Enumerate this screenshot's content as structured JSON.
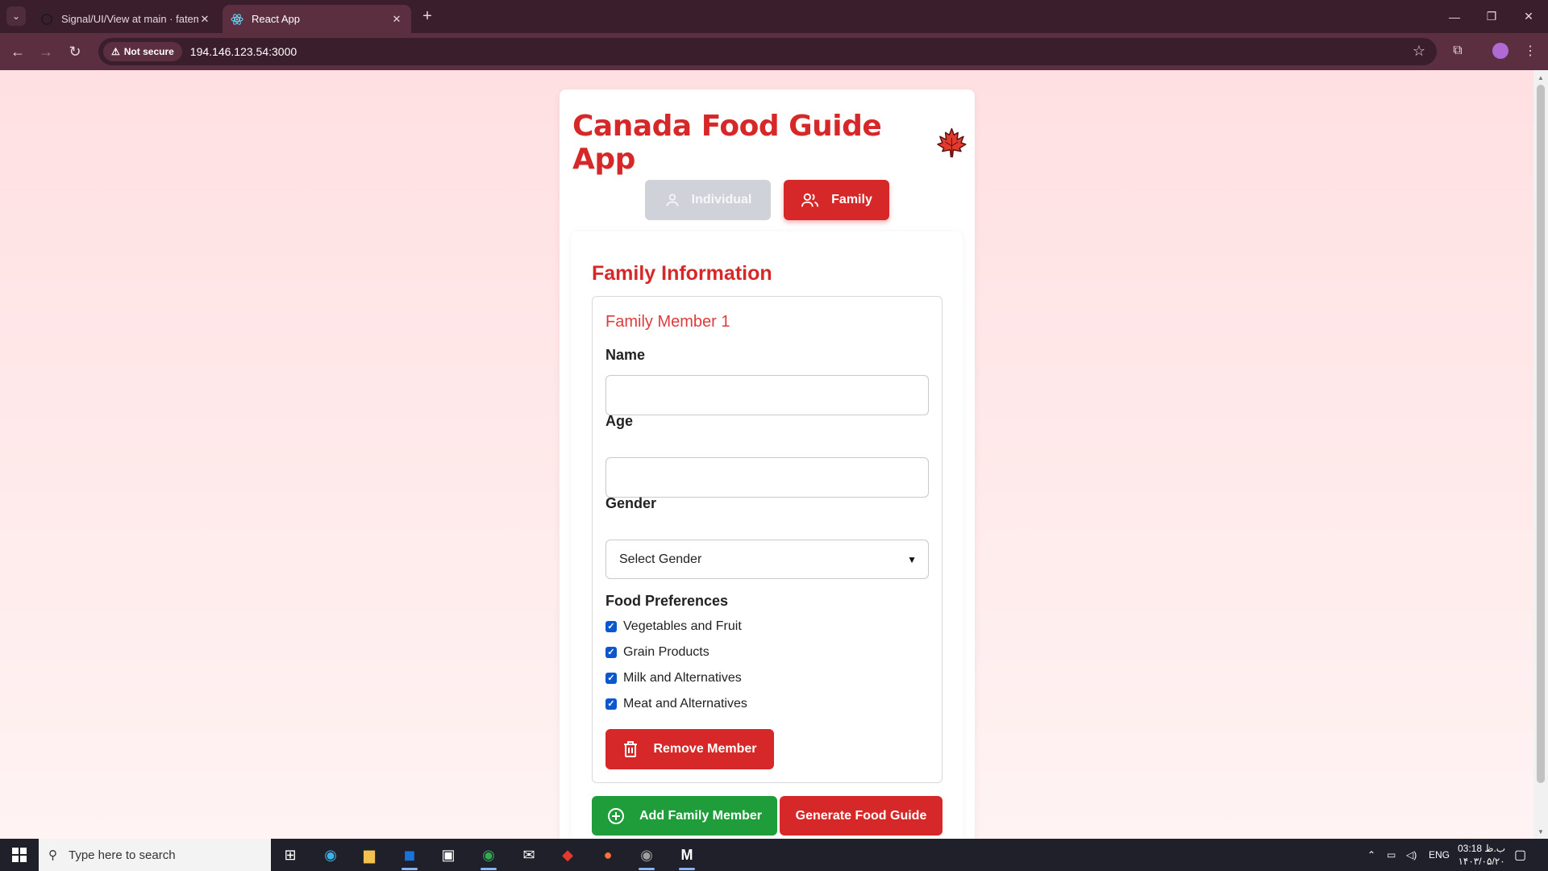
{
  "browser": {
    "tabs": [
      {
        "title": "Signal/UI/View at main · fateme",
        "favicon": "github-icon"
      },
      {
        "title": "React App",
        "favicon": "react-icon"
      }
    ],
    "security_chip": "Not secure",
    "url": "194.146.123.54:3000"
  },
  "app": {
    "title": "Canada Food Guide App",
    "title_icon": "maple-leaf-icon",
    "modes": {
      "individual": "Individual",
      "family": "Family"
    },
    "active_mode": "family",
    "panel_title": "Family Information",
    "member": {
      "title": "Family Member 1",
      "name_label": "Name",
      "name_value": "",
      "age_label": "Age",
      "age_value": "",
      "gender_label": "Gender",
      "gender_selected": "Select Gender",
      "preferences_title": "Food Preferences",
      "preferences": [
        {
          "label": "Vegetables and Fruit",
          "checked": true
        },
        {
          "label": "Grain Products",
          "checked": true
        },
        {
          "label": "Milk and Alternatives",
          "checked": true
        },
        {
          "label": "Meat and Alternatives",
          "checked": true
        }
      ],
      "remove_label": "Remove Member"
    },
    "add_label": "Add Family Member",
    "generate_label": "Generate Food Guide"
  },
  "taskbar": {
    "search_placeholder": "Type here to search",
    "language": "ENG",
    "time": "03:18 ب.ظ",
    "date": "۱۴۰۳/۰۵/۲۰"
  },
  "colors": {
    "brand_red": "#d62828",
    "green": "#1f9d3a",
    "muted_gray": "#cfd2d8"
  }
}
